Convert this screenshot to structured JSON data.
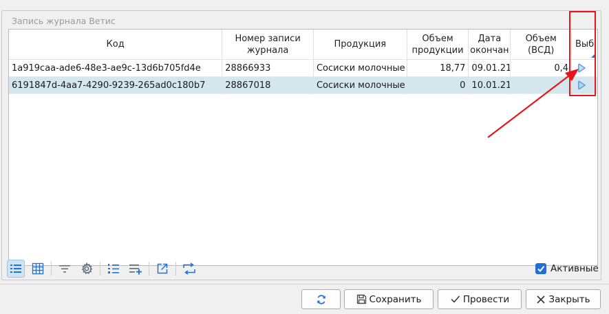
{
  "group": {
    "title": "Запись журнала Ветис"
  },
  "columns": [
    {
      "label": "Код"
    },
    {
      "label": "Номер записи\nжурнала"
    },
    {
      "label": "Продукция"
    },
    {
      "label": "Объем\nпродукции"
    },
    {
      "label": "Дата\nокончан"
    },
    {
      "label": "Объем\n(ВСД)"
    },
    {
      "label": "Выб"
    }
  ],
  "rows": [
    {
      "code": "1a919caa-ade6-48e3-ae9c-13d6b705fd4e",
      "journal_no": "28866933",
      "product": "Сосиски молочные",
      "volume": "18,77",
      "end_date": "09.01.21",
      "vsd_volume": "0,4",
      "select_icon": "play-icon"
    },
    {
      "code": "6191847d-4aa7-4290-9239-265ad0c180b7",
      "journal_no": "28867018",
      "product": "Сосиски молочные",
      "volume": "0",
      "end_date": "10.01.21",
      "vsd_volume": "",
      "select_icon": "play-icon"
    }
  ],
  "toolbar": {
    "icons": [
      "list-view-icon",
      "grid-view-icon",
      "filter-icon",
      "settings-gear-icon",
      "numbered-list-icon",
      "add-list-icon",
      "export-icon",
      "transfer-icon"
    ]
  },
  "active_checkbox": {
    "label": "Активные",
    "checked": true
  },
  "buttons": {
    "refresh_icon": "refresh-icon",
    "save": "Сохранить",
    "post": "Провести",
    "close": "Закрыть"
  },
  "colors": {
    "accent": "#1e6fd9",
    "selection": "#d4e6ee",
    "annotation": "#e8141b"
  }
}
